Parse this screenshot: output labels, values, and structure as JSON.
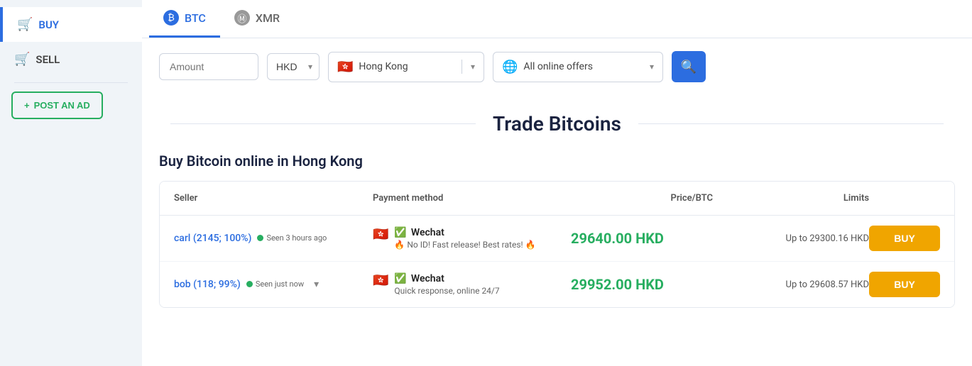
{
  "sidebar": {
    "items": [
      {
        "id": "buy",
        "label": "BUY",
        "icon": "🛒",
        "active": true
      },
      {
        "id": "sell",
        "label": "SELL",
        "icon": "🛒",
        "active": false
      }
    ],
    "post_ad": {
      "label": "POST AN AD",
      "icon": "+"
    }
  },
  "tabs": [
    {
      "id": "btc",
      "label": "BTC",
      "icon": "₿",
      "active": true
    },
    {
      "id": "xmr",
      "label": "XMR",
      "icon": "Ⓜ",
      "active": false
    }
  ],
  "filter": {
    "amount_placeholder": "Amount",
    "currency": "HKD",
    "location_flag": "🇭🇰",
    "location": "Hong Kong",
    "offer_type": "All online offers",
    "search_icon": "🔍"
  },
  "trade_title": "Trade Bitcoins",
  "section_title": "Buy Bitcoin online in Hong Kong",
  "table": {
    "headers": {
      "seller": "Seller",
      "payment_method": "Payment method",
      "price_btc": "Price/BTC",
      "limits": "Limits",
      "action": ""
    },
    "rows": [
      {
        "seller_name": "carl (2145; 100%)",
        "seller_link": "#",
        "status": "Seen 3 hours ago",
        "payment_flag": "🇭🇰",
        "payment_name": "Wechat",
        "payment_desc": "🔥 No ID! Fast release! Best rates! 🔥",
        "price": "29640.00 HKD",
        "limits": "Up to 29300.16 HKD",
        "buy_label": "BUY",
        "has_expand": false
      },
      {
        "seller_name": "bob (118; 99%)",
        "seller_link": "#",
        "status": "Seen just now",
        "payment_flag": "🇭🇰",
        "payment_name": "Wechat",
        "payment_desc": "Quick response, online 24/7",
        "price": "29952.00 HKD",
        "limits": "Up to 29608.57 HKD",
        "buy_label": "BUY",
        "has_expand": true
      }
    ]
  }
}
